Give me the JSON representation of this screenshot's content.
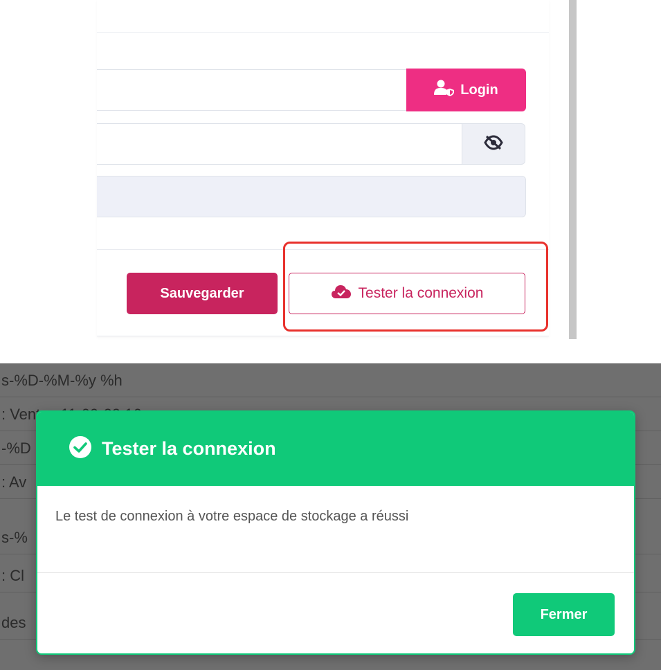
{
  "settings_form": {
    "login_button": "Login",
    "save_button": "Sauvegarder",
    "test_connection_button": "Tester la connexion"
  },
  "background_rows": [
    "s-%D-%M-%y %h",
    ": Ventes 11-09-22 16",
    "-%D",
    ": Av",
    "s-%",
    ": Cl",
    "des"
  ],
  "modal": {
    "title": "Tester la connexion",
    "message": "Le test de connexion à votre espace de stockage a réussi",
    "close_button": "Fermer"
  },
  "colors": {
    "pink": "#ee2e83",
    "crimson": "#c8245e",
    "success_green": "#10c979",
    "highlight_red": "#e8312c"
  },
  "icons": [
    "user-shield-icon",
    "eye-slash-icon",
    "cloud-check-icon",
    "check-circle-icon"
  ]
}
